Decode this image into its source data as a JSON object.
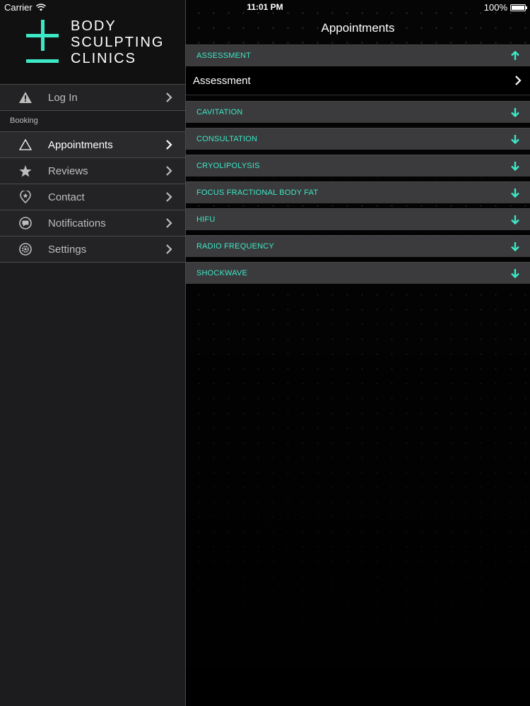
{
  "status_bar": {
    "carrier": "Carrier",
    "time": "11:01 PM",
    "battery": "100%",
    "battery_level": 1.0
  },
  "brand": {
    "line1": "BODY",
    "line2": "SCULPTING",
    "line3": "CLINICS",
    "accent_color": "#3de8c7"
  },
  "sidebar": {
    "login": {
      "label": "Log In",
      "icon": "warning-icon"
    },
    "section_label": "Booking",
    "items": [
      {
        "label": "Appointments",
        "icon": "triangle-icon",
        "active": true
      },
      {
        "label": "Reviews",
        "icon": "star-icon",
        "active": false
      },
      {
        "label": "Contact",
        "icon": "location-pin-icon",
        "active": false
      },
      {
        "label": "Notifications",
        "icon": "chat-bubble-icon",
        "active": false
      },
      {
        "label": "Settings",
        "icon": "gear-icon",
        "active": false
      }
    ]
  },
  "main": {
    "title": "Appointments",
    "sections": [
      {
        "label": "ASSESSMENT",
        "expanded": true,
        "rows": [
          "Assessment"
        ]
      },
      {
        "label": "CAVITATION",
        "expanded": false
      },
      {
        "label": "CONSULTATION",
        "expanded": false
      },
      {
        "label": "CRYOLIPOLYSIS",
        "expanded": false
      },
      {
        "label": "FOCUS FRACTIONAL BODY FAT",
        "expanded": false
      },
      {
        "label": "HIFU",
        "expanded": false
      },
      {
        "label": "RADIO FREQUENCY",
        "expanded": false
      },
      {
        "label": "SHOCKWAVE",
        "expanded": false
      }
    ]
  }
}
